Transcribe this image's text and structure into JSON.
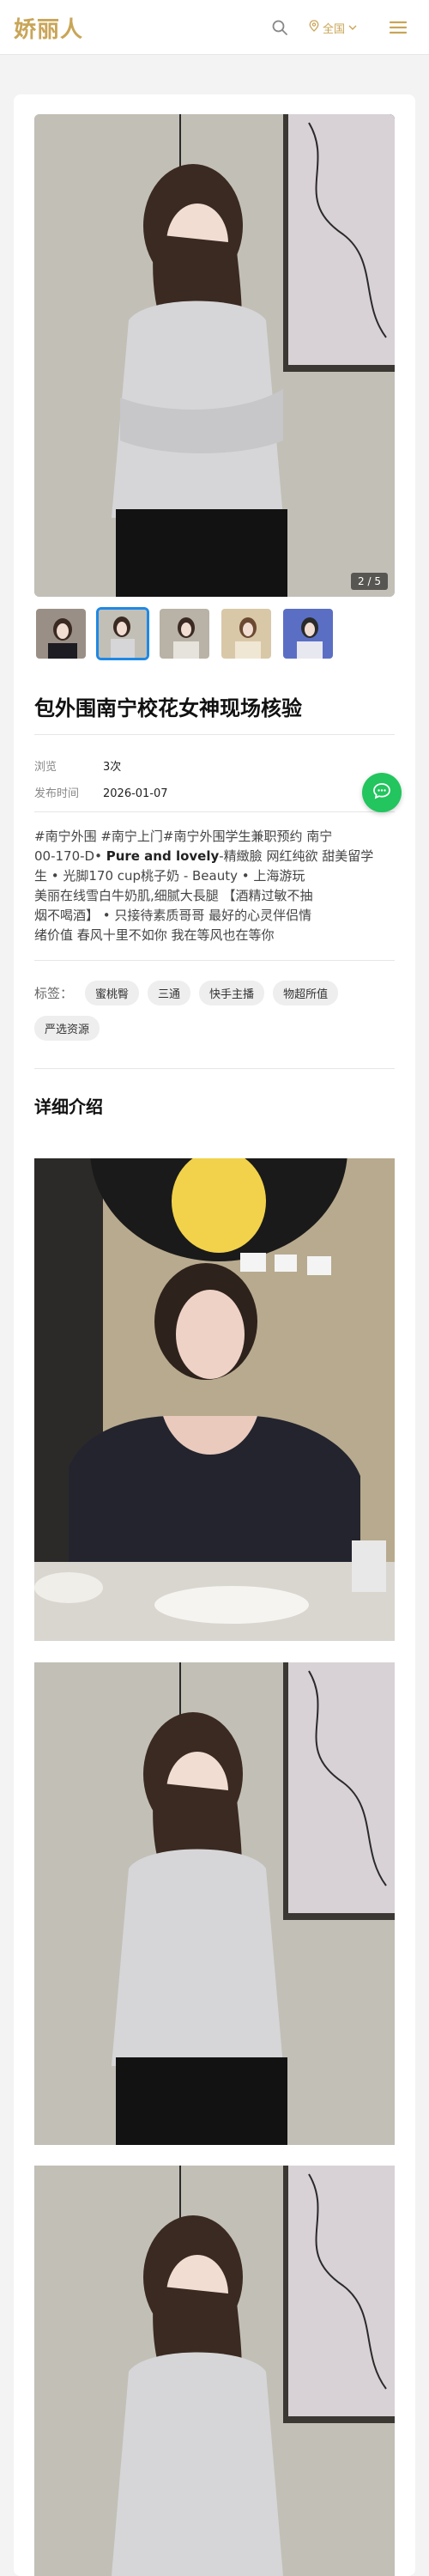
{
  "header": {
    "logo": "娇丽人",
    "location_label": "全国",
    "icons": [
      "search-icon",
      "location-pin-icon",
      "chevron-down-icon",
      "menu-icon"
    ],
    "accent_color": "#c9a557"
  },
  "gallery": {
    "counter": "2 / 5",
    "current_index": 2,
    "total": 5,
    "thumbnails": [
      {
        "label": "photo-1",
        "active": false
      },
      {
        "label": "photo-2",
        "active": true
      },
      {
        "label": "photo-3",
        "active": false
      },
      {
        "label": "photo-4",
        "active": false
      },
      {
        "label": "photo-5",
        "active": false
      }
    ],
    "active_border_color": "#1e88e5"
  },
  "post": {
    "title": "包外围南宁校花女神现场核验",
    "views_label": "浏览",
    "views_value": "3次",
    "date_label": "发布时间",
    "date_value": "2026-01-07",
    "description_line1": "#南宁外围 #南宁上门#南宁外围学生兼职预约   南宁",
    "description_line2a": "00-170-D• ",
    "description_line2b": "Pure and lovely",
    "description_line2c": "-精緻臉 网红纯欲 甜美留学",
    "description_line3": "生    • 光脚170 cup桃子奶 - Beauty  • 上海游玩",
    "description_line4": "  美丽在线雪白牛奶肌,细腻大長腿    【酒精过敏不抽",
    "description_line5": "烟不喝酒】      • 只接待素质哥哥     最好的心灵伴侣情",
    "description_line6": "绪价值     春风十里不如你 我在等风也在等你"
  },
  "tags": {
    "label": "标签：",
    "items": [
      "蜜桃臀",
      "三通",
      "快手主播",
      "物超所值",
      "严选资源"
    ]
  },
  "detail": {
    "title": "详细介绍"
  },
  "fab": {
    "icon": "chat-icon",
    "color": "#22c55e"
  }
}
